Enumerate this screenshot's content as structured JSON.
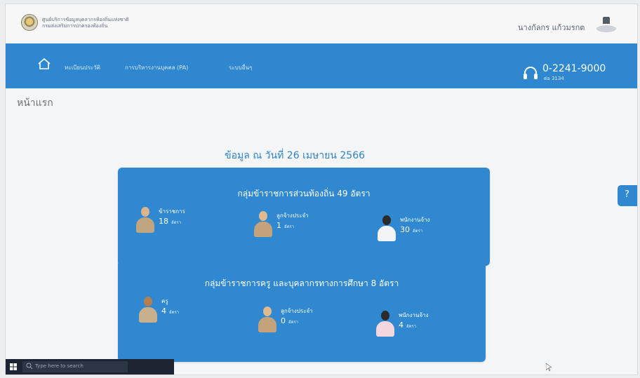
{
  "header": {
    "org_line1": "ศูนย์บริการข้อมูลบุคลากรท้องถิ่นแห่งชาติ",
    "org_line2": "กรมส่งเสริมการปกครองท้องถิ่น",
    "user_name": "นางกัลกร แก้วมรกต"
  },
  "nav": {
    "items": [
      "ทะเบียนประวัติ",
      "การบริหารงานบุคคล (PA)",
      "ระบบอื่นๆ"
    ],
    "phone": "0-2241-9000",
    "ext": "ต่อ 3134"
  },
  "page": {
    "title": "หน้าแรก",
    "date": "ข้อมูล ณ วันที่ 26 เมษายน 2566"
  },
  "groups": [
    {
      "title": "กลุ่มข้าราชการส่วนท้องถิ่น 49 อัตรา",
      "stats": [
        {
          "label": "ข้าราชการ",
          "value": "18",
          "unit": "อัตรา"
        },
        {
          "label": "ลูกจ้างประจำ",
          "value": "1",
          "unit": "อัตรา"
        },
        {
          "label": "พนักงานจ้าง",
          "value": "30",
          "unit": "อัตรา"
        }
      ]
    },
    {
      "title": "กลุ่มข้าราชการครู และบุคลากรทางการศึกษา 8 อัตรา",
      "stats": [
        {
          "label": "ครู",
          "value": "4",
          "unit": "อัตรา"
        },
        {
          "label": "ลูกจ้างประจำ",
          "value": "0",
          "unit": "อัตรา"
        },
        {
          "label": "พนักงานจ้าง",
          "value": "4",
          "unit": "อัตรา"
        }
      ]
    }
  ],
  "help": {
    "icon": "question-icon",
    "symbol": "?"
  },
  "taskbar": {
    "search_placeholder": "Type here to search"
  },
  "colors": {
    "nav": "#2f87cf",
    "card": "#2f88d0",
    "accent_text": "#2f82c8"
  }
}
